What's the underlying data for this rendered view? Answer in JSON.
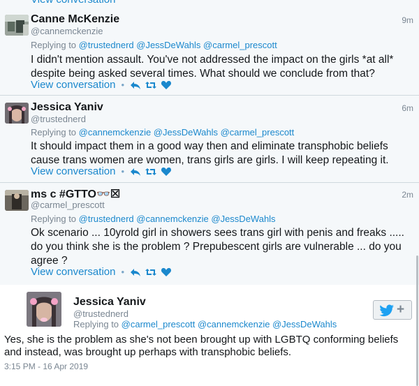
{
  "tweets": [
    {
      "name": "Canne McKenzie",
      "handle": "@cannemckenzie",
      "time": "9m",
      "replying_label": "Replying to",
      "mentions": "@trustednerd @JessDeWahls @carmel_prescott",
      "text": "I didn't mention assault. You've not addressed the impact on the girls *at all* despite being asked several times. What should we conclude from that?",
      "view": "View conversation"
    },
    {
      "name": "Jessica Yaniv",
      "handle": "@trustednerd",
      "time": "6m",
      "replying_label": "Replying to",
      "mentions": "@cannemckenzie @JessDeWahls @carmel_prescott",
      "text": "It should impact them in a good way then and eliminate transphobic beliefs cause trans women are women, trans girls are girls. I will keep repeating it.",
      "view": "View conversation"
    },
    {
      "name": "ms c #GTTO👓☒",
      "handle": "@carmel_prescott",
      "time": "2m",
      "replying_label": "Replying to",
      "mentions": "@trustednerd @cannemckenzie @JessDeWahls",
      "text": "Ok scenario ... 10yrold girl in showers sees trans girl with penis and freaks ..... do you think she is the problem ? Prepubescent girls are vulnerable ... do you agree ?",
      "view": "View conversation"
    }
  ],
  "final": {
    "name": "Jessica Yaniv",
    "handle": "@trustednerd",
    "replying_label": "Replying to",
    "mentions": "@carmel_prescott @cannemckenzie @JessDeWahls",
    "text": "Yes, she is the problem as she's not been brought up with LGBTQ conforming beliefs and instead, was brought up perhaps with transphobic beliefs.",
    "timestamp": "3:15 PM - 16 Apr 2019",
    "follow_plus": "+"
  },
  "top_cutoff_text": "View conversation",
  "colors": {
    "link": "#1b88cd",
    "muted": "#7a8692",
    "background": "#f5f8fa",
    "final_background": "#ffffff",
    "twitter_blue": "#1da1f2"
  }
}
